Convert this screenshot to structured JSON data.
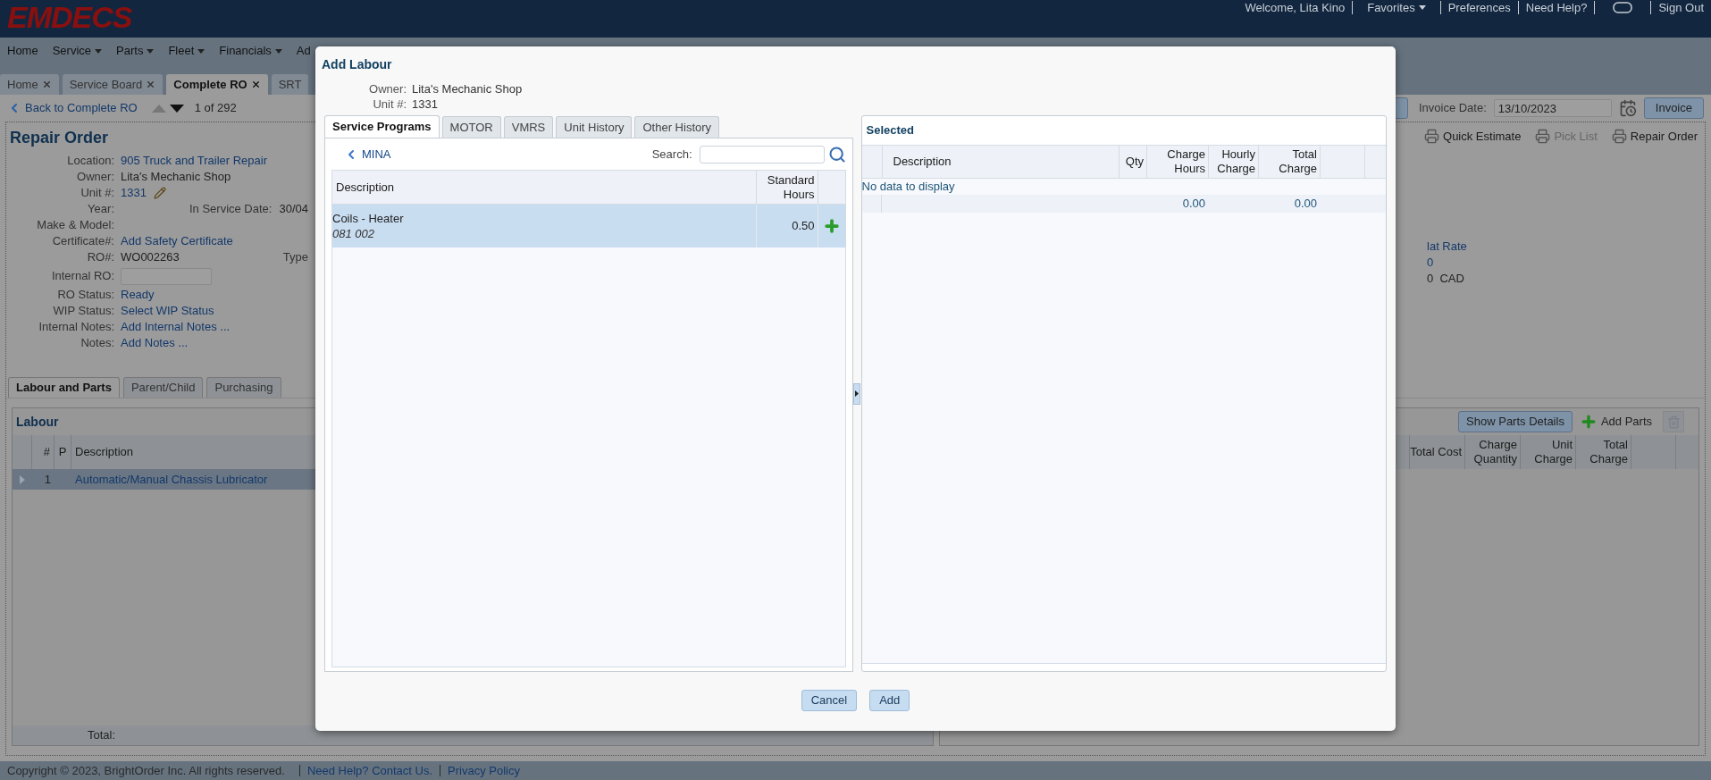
{
  "header": {
    "logo": "EMDECS",
    "links": [
      {
        "kind": "text",
        "label": "Welcome, Lita Kino"
      },
      {
        "kind": "menu",
        "label": "Favorites"
      },
      {
        "kind": "link",
        "label": "Preferences"
      },
      {
        "kind": "link",
        "label": "Need Help?"
      },
      {
        "kind": "chat"
      },
      {
        "kind": "link",
        "label": "Sign Out"
      }
    ]
  },
  "main_menu": [
    {
      "label": "Home",
      "has_menu": false
    },
    {
      "label": "Service",
      "has_menu": true
    },
    {
      "label": "Parts",
      "has_menu": true
    },
    {
      "label": "Fleet",
      "has_menu": true
    },
    {
      "label": "Financials",
      "has_menu": true
    },
    {
      "label": "Ad",
      "has_menu": false
    }
  ],
  "page_tabs": [
    {
      "label": "Home",
      "selected": false,
      "closable": true
    },
    {
      "label": "Service Board",
      "selected": false,
      "closable": true
    },
    {
      "label": "Complete RO",
      "selected": true,
      "closable": true
    },
    {
      "label": "SRT",
      "selected": false,
      "closable": false
    }
  ],
  "navigation": {
    "back_label": "Back to Complete RO",
    "prev_disabled": true,
    "next_disabled": false,
    "position": "1 of 292"
  },
  "invoice": {
    "date_label": "Invoice Date:",
    "date_value": "13/10/2023",
    "button": "Invoice"
  },
  "repair_order": {
    "title": "Repair Order",
    "fields": [
      {
        "label": "Location:",
        "kind": "link",
        "value": "905 Truck and Trailer Repair"
      },
      {
        "label": "Owner:",
        "kind": "text",
        "value": "Lita's Mechanic Shop"
      },
      {
        "label": "Unit #:",
        "kind": "editable",
        "value": "1331"
      },
      {
        "label": "Year:",
        "kind": "text",
        "extra_label": "In Service Date:",
        "extra_value": "30/04"
      },
      {
        "label": "Make & Model:",
        "kind": "text"
      },
      {
        "label": "Certificate#:",
        "kind": "link",
        "value": "Add Safety Certificate"
      },
      {
        "label": "RO#:",
        "kind": "text",
        "value": "WO002263",
        "extra_label": "Type"
      },
      {
        "label": "Internal RO:",
        "kind": "input"
      },
      {
        "label": "RO Status:",
        "kind": "link",
        "value": "Ready"
      },
      {
        "label": "WIP Status:",
        "kind": "link",
        "value": "Select WIP Status"
      },
      {
        "label": "Internal Notes:",
        "kind": "link",
        "value": "Add Internal Notes ..."
      },
      {
        "label": "Notes:",
        "kind": "link",
        "value": "Add Notes ..."
      }
    ]
  },
  "print_actions": [
    {
      "label": "Quick Estimate",
      "disabled": false
    },
    {
      "label": "Pick List",
      "disabled": true
    },
    {
      "label": "Repair Order",
      "disabled": false
    }
  ],
  "rate_values": [
    {
      "kind": "link",
      "text": "lat Rate"
    },
    {
      "kind": "link",
      "text": "0"
    },
    {
      "kind": "text",
      "text": "0  CAD"
    }
  ],
  "detail_tabs": [
    {
      "label": "Labour and Parts",
      "selected": true
    },
    {
      "label": "Parent/Child",
      "selected": false
    },
    {
      "label": "Purchasing",
      "selected": false
    }
  ],
  "labour": {
    "title": "Labour",
    "columns": [
      "#",
      "P",
      "Description"
    ],
    "rows": [
      {
        "number": "1",
        "description": "Automatic/Manual Chassis Lubricator",
        "selected": true
      }
    ],
    "total_label": "Total:"
  },
  "parts": {
    "details_button": "Show Parts Details",
    "add_label": "Add Parts",
    "delete_disabled": true,
    "columns": [
      "Total Cost",
      "Charge Quantity",
      "Unit Charge",
      "Total Charge"
    ]
  },
  "footer": {
    "copyright": "Copyright © 2023, BrightOrder Inc. All rights reserved.",
    "links": [
      "Need Help? Contact Us.",
      "Privacy Policy"
    ]
  },
  "dialog": {
    "title": "Add Labour",
    "info": [
      {
        "label": "Owner:",
        "value": "Lita's Mechanic Shop"
      },
      {
        "label": "Unit #:",
        "value": "1331"
      }
    ],
    "tabs": [
      {
        "label": "Service Programs",
        "selected": true
      },
      {
        "label": "MOTOR",
        "selected": false
      },
      {
        "label": "VMRS",
        "selected": false
      },
      {
        "label": "Unit History",
        "selected": false
      },
      {
        "label": "Other History",
        "selected": false
      }
    ],
    "programs": {
      "back_label": "MINA",
      "search_label": "Search:",
      "columns": [
        "Description",
        "Standard Hours"
      ],
      "rows": [
        {
          "description": "Coils - Heater",
          "code": "081 002",
          "hours": "0.50",
          "selected": true
        }
      ]
    },
    "selected": {
      "title": "Selected",
      "columns": [
        "Description",
        "Qty",
        "Charge Hours",
        "Hourly Charge",
        "Total Charge"
      ],
      "empty_text": "No data to display",
      "charge_hours_total": "0.00",
      "total_charge_total": "0.00"
    },
    "buttons": [
      "Cancel",
      "Add"
    ]
  }
}
